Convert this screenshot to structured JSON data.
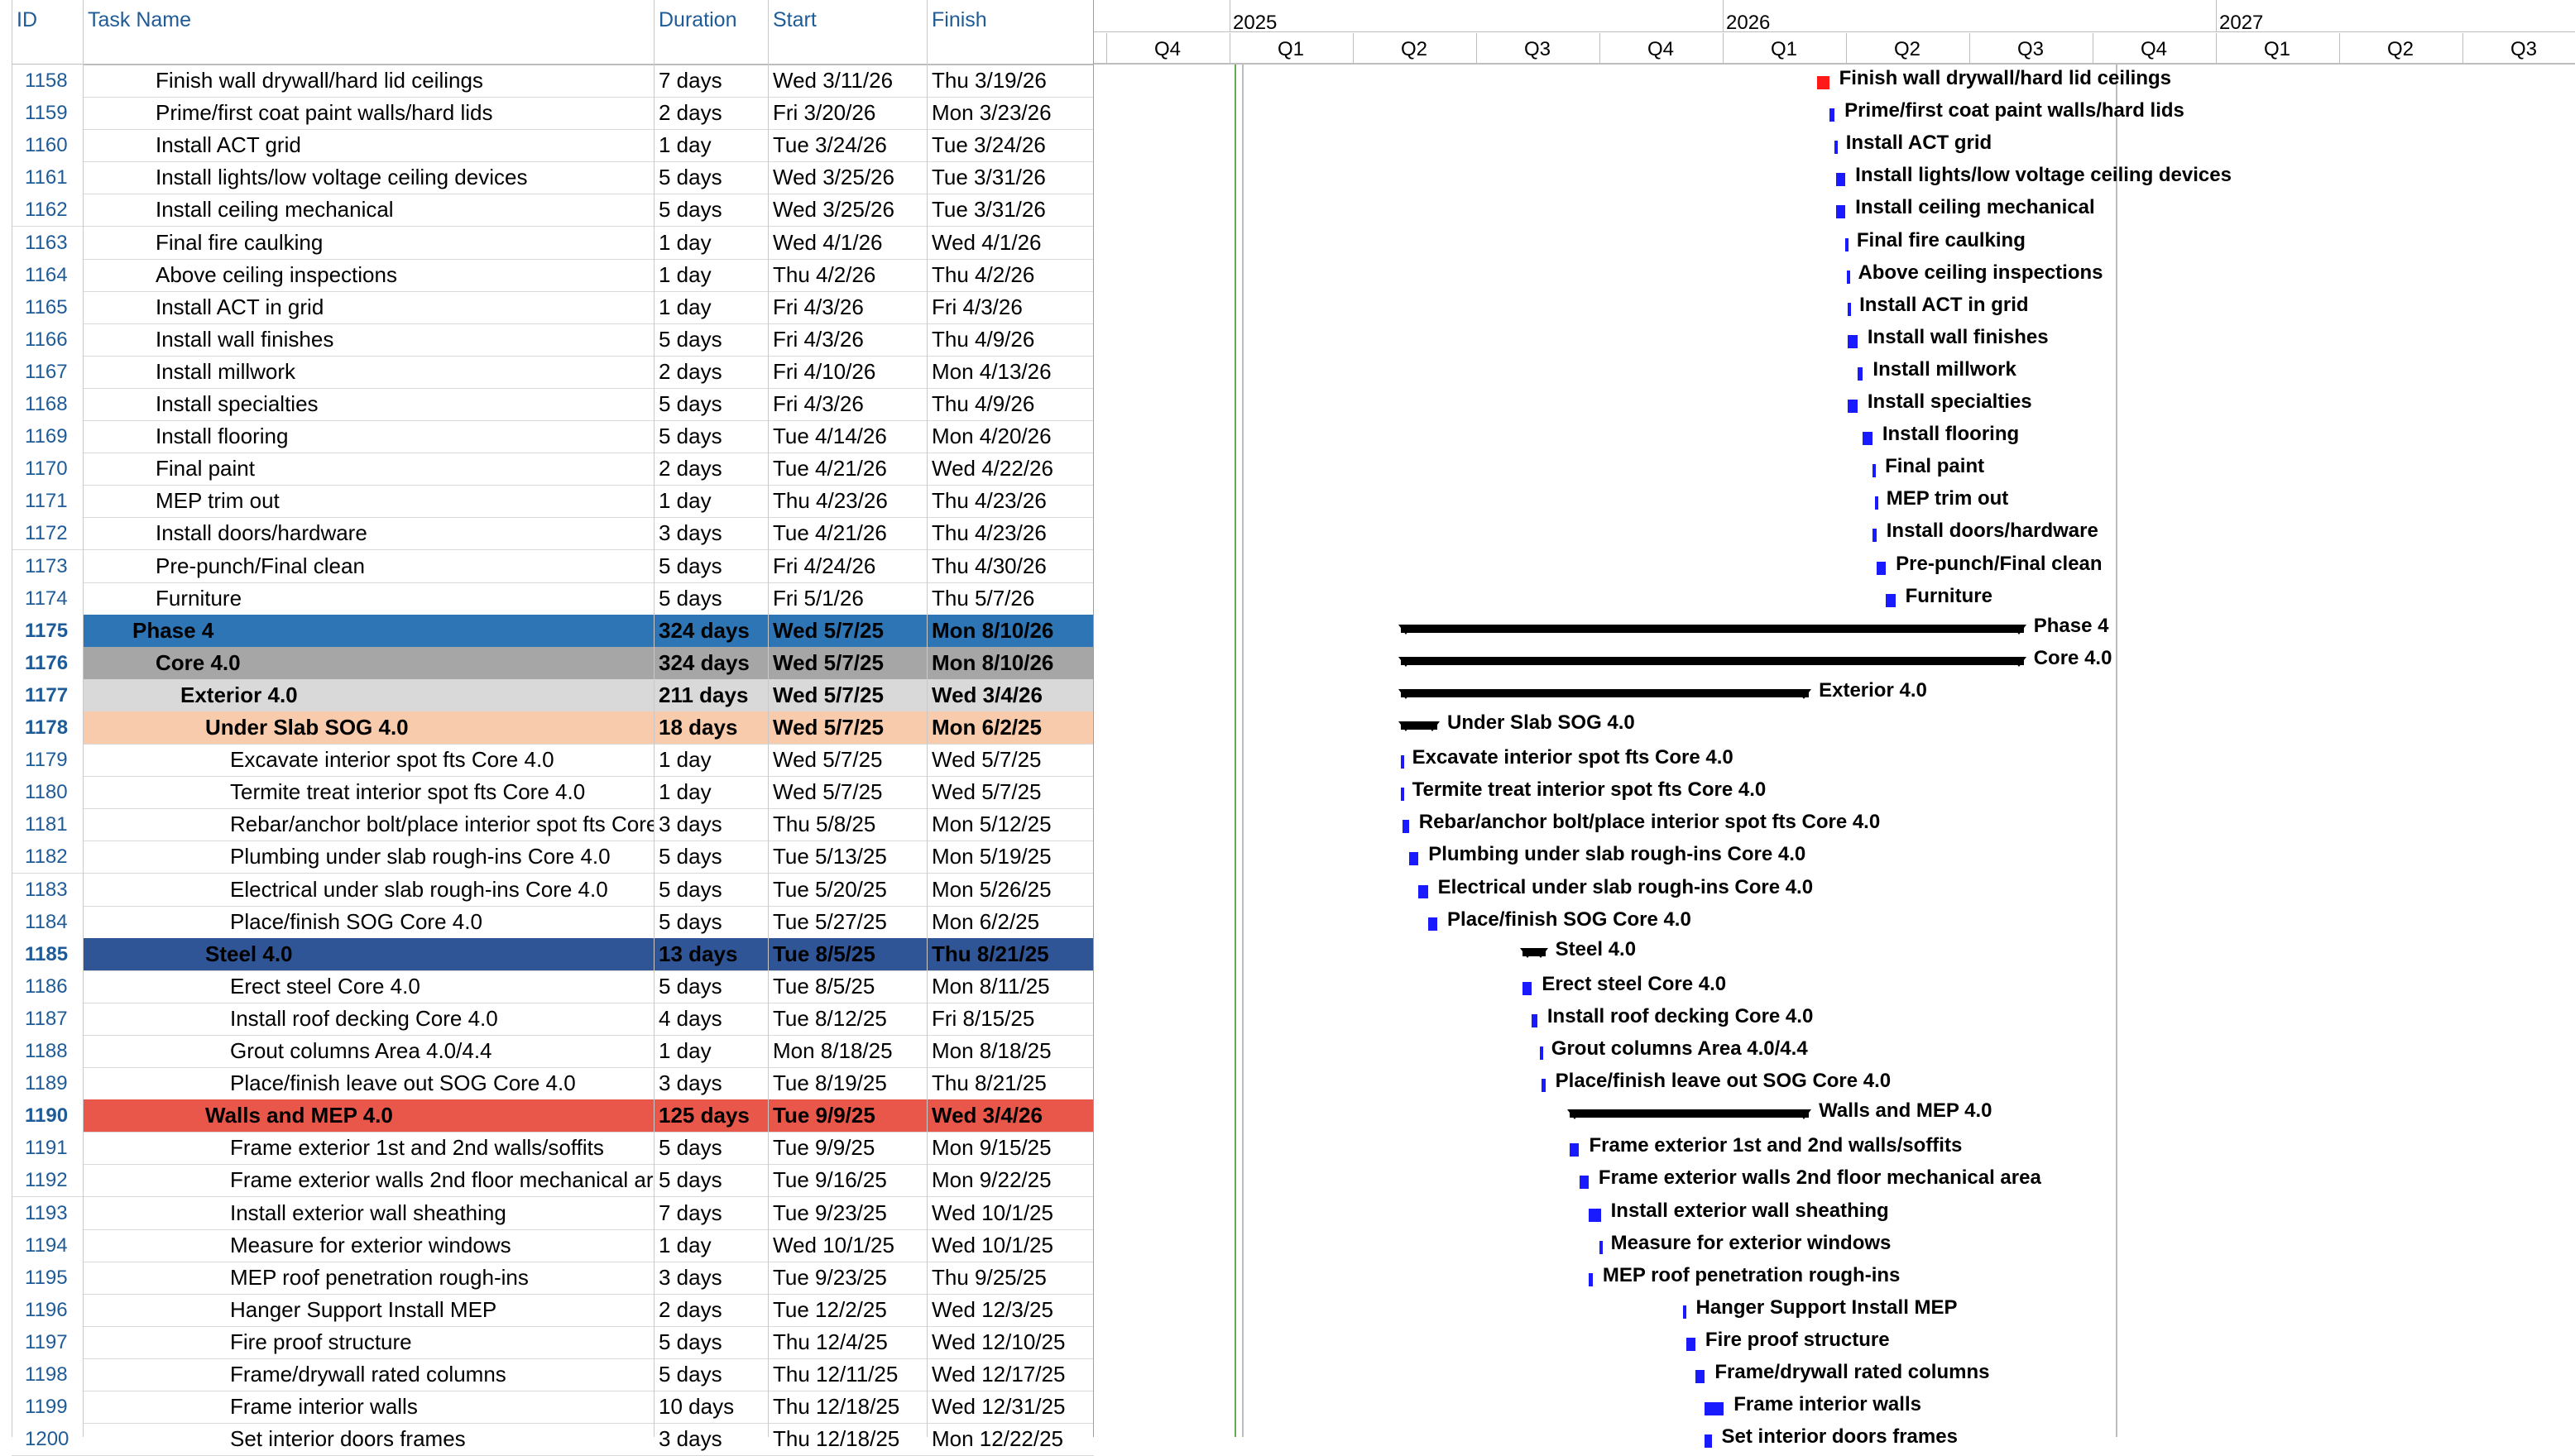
{
  "columns": {
    "id": "ID",
    "name": "Task Name",
    "duration": "Duration",
    "start": "Start",
    "finish": "Finish"
  },
  "timescale": {
    "years": [
      {
        "label": "2025"
      },
      {
        "label": "2026"
      },
      {
        "label": "2027"
      }
    ],
    "quarters": [
      "Q4",
      "Q1",
      "Q2",
      "Q3",
      "Q4",
      "Q1",
      "Q2",
      "Q3",
      "Q4",
      "Q1",
      "Q2",
      "Q3"
    ]
  },
  "colors": {
    "phase": "#2e75b6",
    "core": "#a6a6a6",
    "exterior": "#d9d9d9",
    "underslab": "#f8cbad",
    "steel": "#2f5597",
    "walls": "#e8574a",
    "task_bar": "#1a1aff",
    "critical_bar": "#ff1a1a"
  },
  "tasks": [
    {
      "id": "1158",
      "name": "Finish wall drywall/hard lid ceilings",
      "duration": "7 days",
      "start": "Wed 3/11/26",
      "finish": "Thu 3/19/26",
      "indent": 1,
      "critical": true
    },
    {
      "id": "1159",
      "name": "Prime/first coat paint walls/hard lids",
      "duration": "2 days",
      "start": "Fri 3/20/26",
      "finish": "Mon 3/23/26",
      "indent": 1
    },
    {
      "id": "1160",
      "name": "Install ACT grid",
      "duration": "1 day",
      "start": "Tue 3/24/26",
      "finish": "Tue 3/24/26",
      "indent": 1
    },
    {
      "id": "1161",
      "name": "Install lights/low voltage ceiling devices",
      "duration": "5 days",
      "start": "Wed 3/25/26",
      "finish": "Tue 3/31/26",
      "indent": 1
    },
    {
      "id": "1162",
      "name": "Install ceiling mechanical",
      "duration": "5 days",
      "start": "Wed 3/25/26",
      "finish": "Tue 3/31/26",
      "indent": 1
    },
    {
      "id": "1163",
      "name": "Final fire caulking",
      "duration": "1 day",
      "start": "Wed 4/1/26",
      "finish": "Wed 4/1/26",
      "indent": 1
    },
    {
      "id": "1164",
      "name": "Above ceiling inspections",
      "duration": "1 day",
      "start": "Thu 4/2/26",
      "finish": "Thu 4/2/26",
      "indent": 1
    },
    {
      "id": "1165",
      "name": "Install ACT in grid",
      "duration": "1 day",
      "start": "Fri 4/3/26",
      "finish": "Fri 4/3/26",
      "indent": 1
    },
    {
      "id": "1166",
      "name": "Install wall finishes",
      "duration": "5 days",
      "start": "Fri 4/3/26",
      "finish": "Thu 4/9/26",
      "indent": 1
    },
    {
      "id": "1167",
      "name": "Install millwork",
      "duration": "2 days",
      "start": "Fri 4/10/26",
      "finish": "Mon 4/13/26",
      "indent": 1
    },
    {
      "id": "1168",
      "name": "Install specialties",
      "duration": "5 days",
      "start": "Fri 4/3/26",
      "finish": "Thu 4/9/26",
      "indent": 1
    },
    {
      "id": "1169",
      "name": "Install flooring",
      "duration": "5 days",
      "start": "Tue 4/14/26",
      "finish": "Mon 4/20/26",
      "indent": 1
    },
    {
      "id": "1170",
      "name": "Final paint",
      "duration": "2 days",
      "start": "Tue 4/21/26",
      "finish": "Wed 4/22/26",
      "indent": 1
    },
    {
      "id": "1171",
      "name": "MEP trim out",
      "duration": "1 day",
      "start": "Thu 4/23/26",
      "finish": "Thu 4/23/26",
      "indent": 1
    },
    {
      "id": "1172",
      "name": "Install doors/hardware",
      "duration": "3 days",
      "start": "Tue 4/21/26",
      "finish": "Thu 4/23/26",
      "indent": 1
    },
    {
      "id": "1173",
      "name": "Pre-punch/Final clean",
      "duration": "5 days",
      "start": "Fri 4/24/26",
      "finish": "Thu 4/30/26",
      "indent": 1
    },
    {
      "id": "1174",
      "name": "Furniture",
      "duration": "5 days",
      "start": "Fri 5/1/26",
      "finish": "Thu 5/7/26",
      "indent": 1
    },
    {
      "id": "1175",
      "name": "Phase 4",
      "duration": "324 days",
      "start": "Wed 5/7/25",
      "finish": "Mon 8/10/26",
      "indent": 0,
      "summary": true,
      "color": "phase"
    },
    {
      "id": "1176",
      "name": "Core 4.0",
      "duration": "324 days",
      "start": "Wed 5/7/25",
      "finish": "Mon 8/10/26",
      "indent": 1,
      "summary": true,
      "color": "core"
    },
    {
      "id": "1177",
      "name": "Exterior 4.0",
      "duration": "211 days",
      "start": "Wed 5/7/25",
      "finish": "Wed 3/4/26",
      "indent": 2,
      "summary": true,
      "color": "exterior"
    },
    {
      "id": "1178",
      "name": "Under Slab SOG 4.0",
      "duration": "18 days",
      "start": "Wed 5/7/25",
      "finish": "Mon 6/2/25",
      "indent": 3,
      "summary": true,
      "color": "underslab"
    },
    {
      "id": "1179",
      "name": "Excavate interior spot fts Core 4.0",
      "duration": "1 day",
      "start": "Wed 5/7/25",
      "finish": "Wed 5/7/25",
      "indent": 4
    },
    {
      "id": "1180",
      "name": "Termite treat interior spot fts Core 4.0",
      "duration": "1 day",
      "start": "Wed 5/7/25",
      "finish": "Wed 5/7/25",
      "indent": 4
    },
    {
      "id": "1181",
      "name": "Rebar/anchor bolt/place interior spot fts Core 4.0",
      "duration": "3 days",
      "start": "Thu 5/8/25",
      "finish": "Mon 5/12/25",
      "indent": 4
    },
    {
      "id": "1182",
      "name": "Plumbing under slab rough-ins Core 4.0",
      "duration": "5 days",
      "start": "Tue 5/13/25",
      "finish": "Mon 5/19/25",
      "indent": 4
    },
    {
      "id": "1183",
      "name": "Electrical under slab rough-ins Core 4.0",
      "duration": "5 days",
      "start": "Tue 5/20/25",
      "finish": "Mon 5/26/25",
      "indent": 4
    },
    {
      "id": "1184",
      "name": "Place/finish SOG Core 4.0",
      "duration": "5 days",
      "start": "Tue 5/27/25",
      "finish": "Mon 6/2/25",
      "indent": 4
    },
    {
      "id": "1185",
      "name": "Steel 4.0",
      "duration": "13 days",
      "start": "Tue 8/5/25",
      "finish": "Thu 8/21/25",
      "indent": 3,
      "summary": true,
      "color": "steel"
    },
    {
      "id": "1186",
      "name": "Erect steel Core 4.0",
      "duration": "5 days",
      "start": "Tue 8/5/25",
      "finish": "Mon 8/11/25",
      "indent": 4
    },
    {
      "id": "1187",
      "name": "Install roof decking Core 4.0",
      "duration": "4 days",
      "start": "Tue 8/12/25",
      "finish": "Fri 8/15/25",
      "indent": 4
    },
    {
      "id": "1188",
      "name": "Grout columns Area 4.0/4.4",
      "duration": "1 day",
      "start": "Mon 8/18/25",
      "finish": "Mon 8/18/25",
      "indent": 4
    },
    {
      "id": "1189",
      "name": "Place/finish leave out SOG Core 4.0",
      "duration": "3 days",
      "start": "Tue 8/19/25",
      "finish": "Thu 8/21/25",
      "indent": 4
    },
    {
      "id": "1190",
      "name": "Walls and MEP 4.0",
      "duration": "125 days",
      "start": "Tue 9/9/25",
      "finish": "Wed 3/4/26",
      "indent": 3,
      "summary": true,
      "color": "walls"
    },
    {
      "id": "1191",
      "name": "Frame exterior 1st and 2nd walls/soffits",
      "duration": "5 days",
      "start": "Tue 9/9/25",
      "finish": "Mon 9/15/25",
      "indent": 4
    },
    {
      "id": "1192",
      "name": "Frame exterior walls 2nd floor mechanical area",
      "duration": "5 days",
      "start": "Tue 9/16/25",
      "finish": "Mon 9/22/25",
      "indent": 4
    },
    {
      "id": "1193",
      "name": "Install exterior wall sheathing",
      "duration": "7 days",
      "start": "Tue 9/23/25",
      "finish": "Wed 10/1/25",
      "indent": 4
    },
    {
      "id": "1194",
      "name": "Measure for exterior windows",
      "duration": "1 day",
      "start": "Wed 10/1/25",
      "finish": "Wed 10/1/25",
      "indent": 4
    },
    {
      "id": "1195",
      "name": "MEP roof penetration rough-ins",
      "duration": "3 days",
      "start": "Tue 9/23/25",
      "finish": "Thu 9/25/25",
      "indent": 4
    },
    {
      "id": "1196",
      "name": "Hanger Support Install MEP",
      "duration": "2 days",
      "start": "Tue 12/2/25",
      "finish": "Wed 12/3/25",
      "indent": 4
    },
    {
      "id": "1197",
      "name": "Fire proof structure",
      "duration": "5 days",
      "start": "Thu 12/4/25",
      "finish": "Wed 12/10/25",
      "indent": 4
    },
    {
      "id": "1198",
      "name": "Frame/drywall rated columns",
      "duration": "5 days",
      "start": "Thu 12/11/25",
      "finish": "Wed 12/17/25",
      "indent": 4
    },
    {
      "id": "1199",
      "name": "Frame interior walls",
      "duration": "10 days",
      "start": "Thu 12/18/25",
      "finish": "Wed 12/31/25",
      "indent": 4
    },
    {
      "id": "1200",
      "name": "Set interior doors frames",
      "duration": "3 days",
      "start": "Thu 12/18/25",
      "finish": "Mon 12/22/25",
      "indent": 4
    }
  ]
}
